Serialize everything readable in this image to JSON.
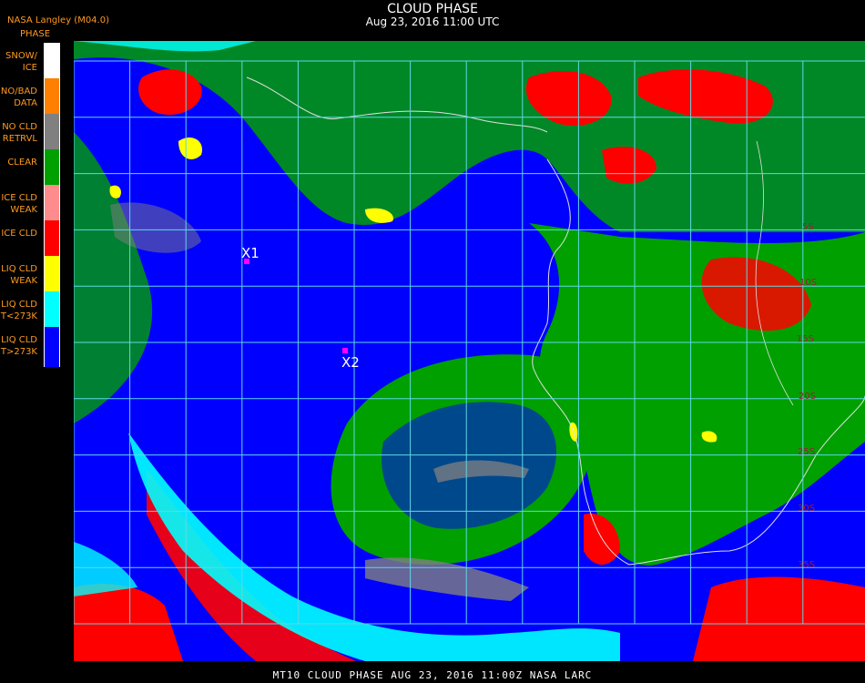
{
  "header": {
    "producer": "NASA Langley (M04.0)",
    "title": "CLOUD PHASE",
    "subtitle": "Aug 23, 2016 11:00 UTC"
  },
  "legend": {
    "heading": "PHASE",
    "items": [
      {
        "label": "SNOW/\nICE",
        "color": "#ffffff"
      },
      {
        "label": "NO/BAD\nDATA",
        "color": "#ff7f00"
      },
      {
        "label": "NO CLD\nRETRVL",
        "color": "#808080"
      },
      {
        "label": "CLEAR",
        "color": "#00a000"
      },
      {
        "label": "ICE CLD\nWEAK",
        "color": "#ff8c8c"
      },
      {
        "label": "ICE CLD",
        "color": "#ff0000"
      },
      {
        "label": "LIQ CLD\nWEAK",
        "color": "#ffff00"
      },
      {
        "label": "LIQ CLD\nT<273K",
        "color": "#00ffff"
      },
      {
        "label": "LIQ CLD\nT>273K",
        "color": "#0000ff"
      }
    ]
  },
  "markers": [
    {
      "label": "X1",
      "color": "#ff00ff"
    },
    {
      "label": "X2",
      "color": "#ff00ff"
    }
  ],
  "lat_labels": [
    "5S",
    "10S",
    "15S",
    "20S",
    "25S",
    "30S",
    "35S"
  ],
  "footer": {
    "caption": "MT10  CLOUD PHASE   AUG 23, 2016 11:00Z   NASA LARC"
  },
  "colors": {
    "grid": "#5fd7e6",
    "coast": "#e0e0e0",
    "background": "#000000"
  }
}
